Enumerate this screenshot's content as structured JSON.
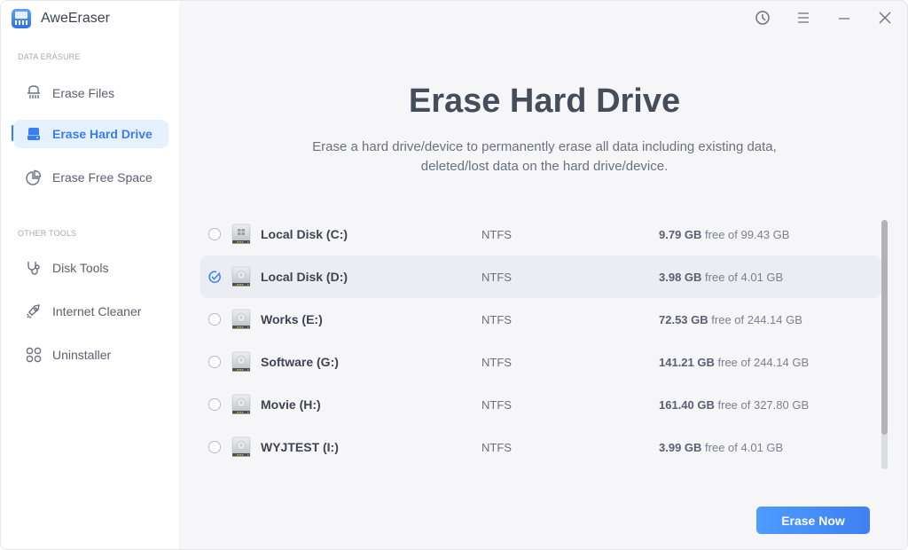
{
  "app": {
    "title": "AweEraser",
    "icons": {
      "logo": "shredder-logo-icon"
    }
  },
  "titlebar": {
    "buttons": [
      {
        "name": "history",
        "icon": "clock-icon"
      },
      {
        "name": "menu",
        "icon": "hamburger-menu-icon"
      },
      {
        "name": "minimize",
        "icon": "minimize-icon"
      },
      {
        "name": "close",
        "icon": "close-icon"
      }
    ]
  },
  "sidebar": {
    "sections": [
      {
        "label": "DATA ERASURE",
        "items": [
          {
            "label": "Erase Files",
            "icon": "shredder-icon",
            "active": false
          },
          {
            "label": "Erase Hard Drive",
            "icon": "hard-drive-icon",
            "active": true
          },
          {
            "label": "Erase Free Space",
            "icon": "pie-chart-icon",
            "active": false
          }
        ]
      },
      {
        "label": "OTHER TOOLS",
        "items": [
          {
            "label": "Disk Tools",
            "icon": "stethoscope-icon",
            "active": false
          },
          {
            "label": "Internet Cleaner",
            "icon": "rocket-icon",
            "active": false
          },
          {
            "label": "Uninstaller",
            "icon": "grid-apps-icon",
            "active": false
          }
        ]
      }
    ]
  },
  "main": {
    "title": "Erase Hard Drive",
    "description_line1": "Erase a hard drive/device to permanently erase all data including existing data,",
    "description_line2": "deleted/lost data on the hard drive/device.",
    "drives": [
      {
        "name": "Local Disk (C:)",
        "fs": "NTFS",
        "free": "9.79 GB",
        "of_text": "free of 99.43 GB",
        "selected": false,
        "system": true
      },
      {
        "name": "Local Disk (D:)",
        "fs": "NTFS",
        "free": "3.98 GB",
        "of_text": "free of 4.01 GB",
        "selected": true,
        "system": false
      },
      {
        "name": "Works (E:)",
        "fs": "NTFS",
        "free": "72.53 GB",
        "of_text": "free of 244.14 GB",
        "selected": false,
        "system": false
      },
      {
        "name": "Software (G:)",
        "fs": "NTFS",
        "free": "141.21 GB",
        "of_text": "free of 244.14 GB",
        "selected": false,
        "system": false
      },
      {
        "name": "Movie (H:)",
        "fs": "NTFS",
        "free": "161.40 GB",
        "of_text": "free of 327.80 GB",
        "selected": false,
        "system": false
      },
      {
        "name": "WYJTEST (I:)",
        "fs": "NTFS",
        "free": "3.99 GB",
        "of_text": "free of 4.01 GB",
        "selected": false,
        "system": false
      }
    ],
    "erase_button": "Erase Now"
  },
  "colors": {
    "accent": "#3a7df0",
    "active_bg": "#e6f1ff",
    "main_bg": "#f6f6f9"
  }
}
